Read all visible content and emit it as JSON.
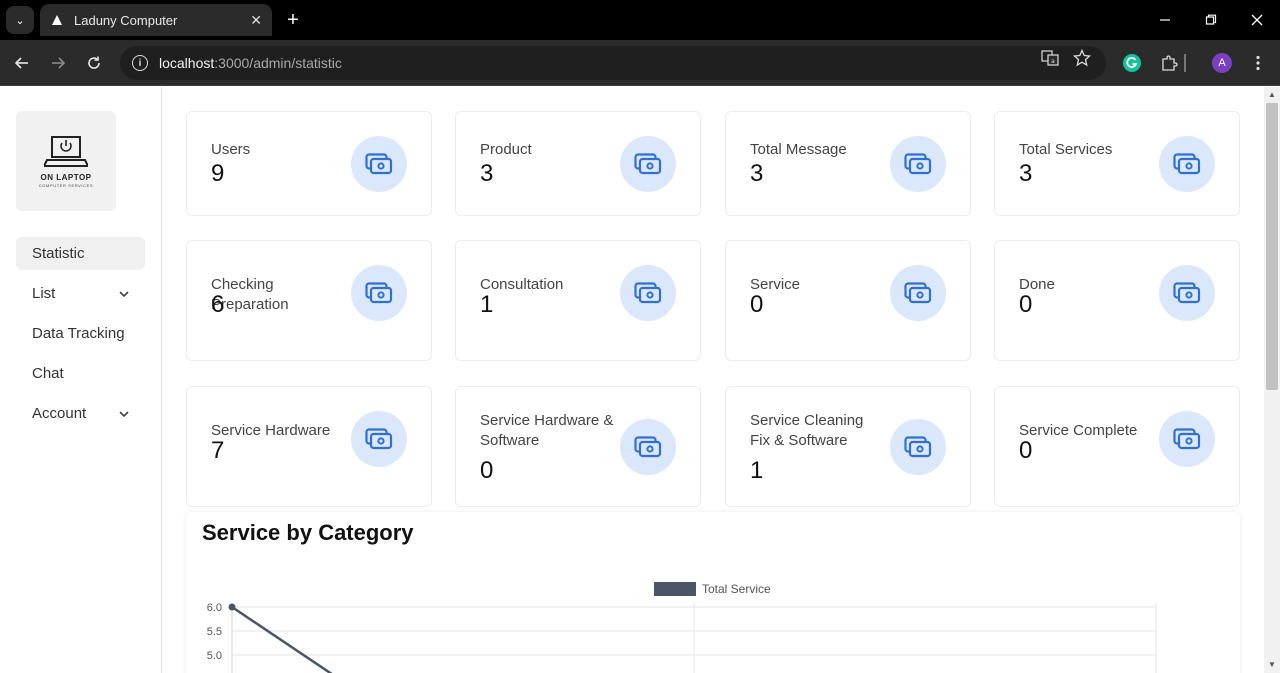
{
  "browser": {
    "tab_title": "Laduny Computer",
    "tab_close": "✕",
    "new_tab": "+",
    "url_host": "localhost",
    "url_path": ":3000/admin/statistic",
    "avatar_letter": "A"
  },
  "sidebar": {
    "logo_name": "ON LAPTOP",
    "logo_sub": "COMPUTER SERVICES",
    "items": [
      {
        "label": "Statistic",
        "active": true
      },
      {
        "label": "List",
        "has_dropdown": true
      },
      {
        "label": "Data Tracking"
      },
      {
        "label": "Chat"
      },
      {
        "label": "Account",
        "has_dropdown": true
      }
    ]
  },
  "stats": [
    {
      "label": "Users",
      "value": "9"
    },
    {
      "label": "Product",
      "value": "3"
    },
    {
      "label": "Total Message",
      "value": "3"
    },
    {
      "label": "Total Services",
      "value": "3"
    },
    {
      "label": "Checking Preparation",
      "value": "6"
    },
    {
      "label": "Consultation",
      "value": "1"
    },
    {
      "label": "Service",
      "value": "0"
    },
    {
      "label": "Done",
      "value": "0"
    },
    {
      "label": "Service Hardware",
      "value": "7"
    },
    {
      "label": "Service Hardware & Software",
      "value": "0"
    },
    {
      "label": "Service Cleaning Fix & Software",
      "value": "1"
    },
    {
      "label": "Service Complete",
      "value": "0"
    }
  ],
  "icon_color": "#2f6fd6",
  "chart_section": {
    "title": "Service by Category"
  },
  "chart_data": {
    "type": "line",
    "legend": [
      "Total Service"
    ],
    "series": [
      {
        "name": "Total Service",
        "color": "#4a5568",
        "values": [
          6
        ]
      }
    ],
    "y_ticks": [
      "6.0",
      "5.5",
      "5.0"
    ],
    "grid": true,
    "legend_position": "top-center"
  }
}
